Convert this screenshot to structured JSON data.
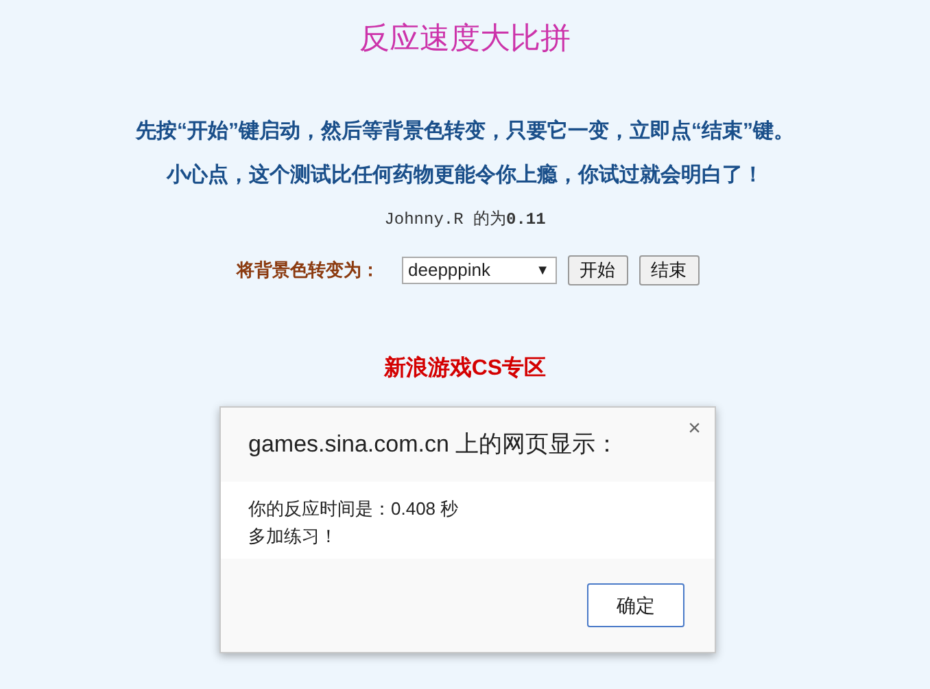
{
  "page": {
    "title": "反应速度大比拼",
    "instructions": [
      "先按“开始”键启动，然后等背景色转变，只要它一变，立即点“结束”键。",
      "小心点，这个测试比任何药物更能令你上瘾，你试过就会明白了！"
    ],
    "record": "Johnny.R 的为**0.11**",
    "color_label": "将背景色转变为：",
    "color_select": {
      "value": "deepppink",
      "arrow": "▼"
    },
    "buttons": [
      "开始",
      "结束"
    ],
    "footer_link": "新浪游戏CS专区"
  },
  "dialog": {
    "title": "games.sina.com.cn 上的网页显示：",
    "close": "×",
    "message": [
      "你的反应时间是：0.408 秒",
      "多加练习！"
    ],
    "ok_button": "确定"
  }
}
